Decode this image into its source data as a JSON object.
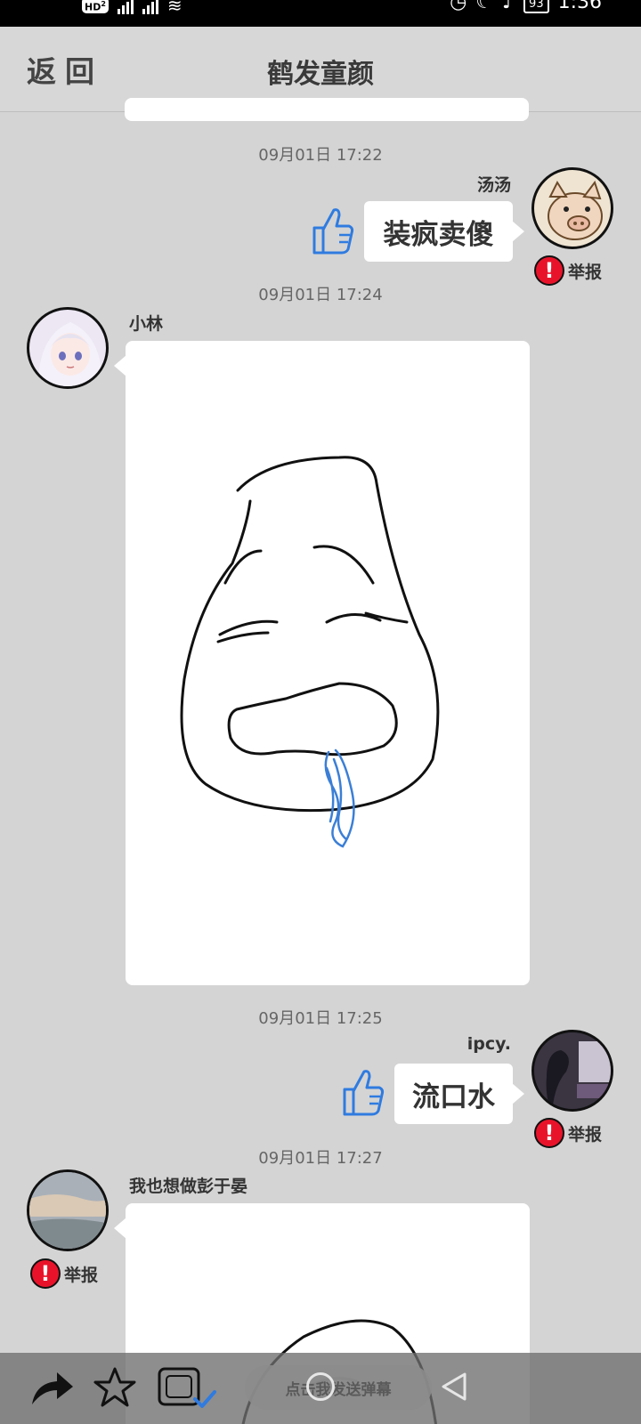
{
  "status_bar": {
    "network": "HD",
    "sim": "2",
    "battery": "93",
    "time": "1:36"
  },
  "header": {
    "back_label": "返回",
    "title": "鹤发童颜"
  },
  "messages": [
    {
      "time": "09月01日  17:22",
      "user": "汤汤",
      "text": "装疯卖傻",
      "side": "right",
      "report_label": "举报"
    },
    {
      "time": "09月01日  17:24",
      "user": "小林",
      "content": "drawing",
      "side": "left"
    },
    {
      "time": "09月01日  17:25",
      "user": "ipcy.",
      "text": "流口水",
      "side": "right",
      "report_label": "举报"
    },
    {
      "time": "09月01日  17:27",
      "user": "我也想做彭于晏",
      "content": "drawing",
      "side": "left",
      "report_label": "举报"
    }
  ],
  "toolbar": {
    "danmu_placeholder": "点击我发送弹幕",
    "icons": [
      "share-icon",
      "star-icon",
      "barrage-toggle-icon"
    ]
  },
  "colors": {
    "background": "#d4d4d4",
    "report_red": "#e8132a",
    "like_blue": "#2f7be0",
    "drool_blue": "#3b7fd6"
  }
}
